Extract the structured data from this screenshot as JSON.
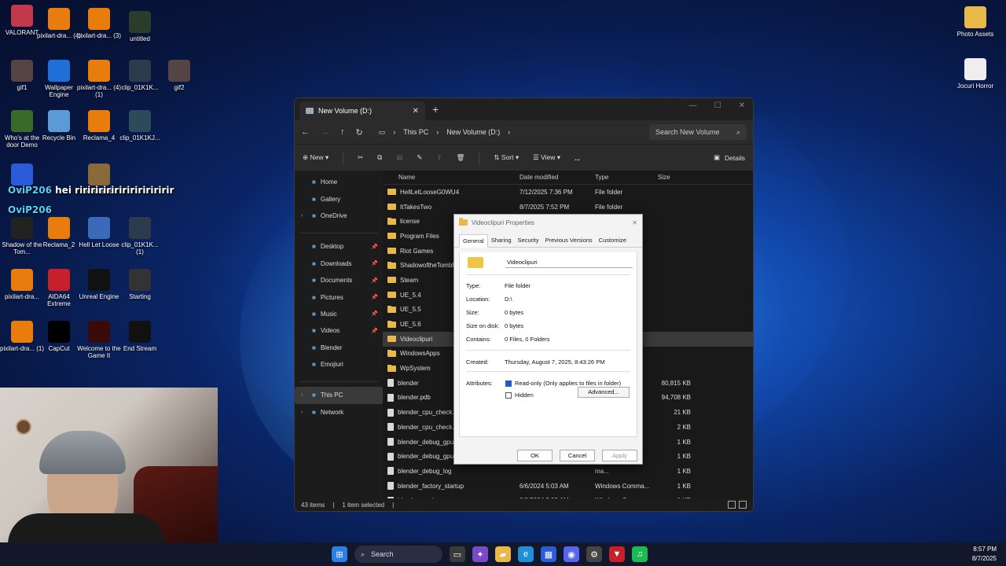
{
  "desktop": {
    "icons": [
      {
        "label": "VALORANT",
        "icon": "valorant-icon",
        "color": "#c23a4a"
      },
      {
        "label": "pixilart-dra... (4)",
        "icon": "blender-icon",
        "color": "#e87d0d"
      },
      {
        "label": "pixilart-dra... (3)",
        "icon": "blender-icon",
        "color": "#e87d0d"
      },
      {
        "label": "untitled",
        "icon": "image-icon",
        "color": "#2c3c2c"
      },
      {
        "label": "gif1",
        "icon": "image-icon",
        "color": "#554444"
      },
      {
        "label": "Wallpaper Engine",
        "icon": "wallpaper-engine-icon",
        "color": "#1f6fd8"
      },
      {
        "label": "pixilart-dra... (4) (1)",
        "icon": "blender-icon",
        "color": "#e87d0d"
      },
      {
        "label": "clip_01K1K...",
        "icon": "video-icon",
        "color": "#2b3b4b"
      },
      {
        "label": "gif2",
        "icon": "image-icon",
        "color": "#554444"
      },
      {
        "label": "Who's at the door Demo",
        "icon": "game-icon",
        "color": "#3a6a2a"
      },
      {
        "label": "Recycle Bin",
        "icon": "recycle-bin-icon",
        "color": "#5b9bd5"
      },
      {
        "label": "Reclama_4",
        "icon": "blender-icon",
        "color": "#e87d0d"
      },
      {
        "label": "clip_01K1KJ...",
        "icon": "video-icon",
        "color": "#2b4b5b"
      },
      {
        "label": "Ro",
        "icon": "roblox-icon",
        "color": "#2a5bd8"
      },
      {
        "label": "Mechanic",
        "icon": "game-icon",
        "color": "#8a6a3a"
      },
      {
        "label": "Shadow of the Tom...",
        "icon": "game-icon",
        "color": "#222222"
      },
      {
        "label": "Reclama_2",
        "icon": "blender-icon",
        "color": "#e87d0d"
      },
      {
        "label": "Hell Let Loose",
        "icon": "game-icon",
        "color": "#3a6ab8"
      },
      {
        "label": "clip_01K1K... (1)",
        "icon": "video-icon",
        "color": "#2b3b4b"
      },
      {
        "label": "pixilart-dra...",
        "icon": "blender-icon",
        "color": "#e87d0d"
      },
      {
        "label": "AIDA64 Extreme",
        "icon": "aida64-icon",
        "color": "#c8202a"
      },
      {
        "label": "Unreal Engine",
        "icon": "unreal-icon",
        "color": "#111111"
      },
      {
        "label": "Starting",
        "icon": "image-icon",
        "color": "#333333"
      },
      {
        "label": "pixilart-dra... (1)",
        "icon": "blender-icon",
        "color": "#e87d0d"
      },
      {
        "label": "CapCut",
        "icon": "capcut-icon",
        "color": "#000000"
      },
      {
        "label": "Welcome to the Game II",
        "icon": "game-icon",
        "color": "#3a0a0a"
      },
      {
        "label": "End Stream",
        "icon": "image-icon",
        "color": "#111111"
      },
      {
        "label": "Photo Assets",
        "icon": "folder-icon",
        "color": "#e8b84a"
      },
      {
        "label": "Jocuri Horror",
        "icon": "file-icon",
        "color": "#eeeeee"
      }
    ]
  },
  "chat": [
    {
      "user": "OviP206",
      "message": "hei ririririririririririririr"
    },
    {
      "user": "OviP206",
      "message": ""
    }
  ],
  "explorer": {
    "tab_title": "New Volume (D:)",
    "breadcrumb": [
      "This PC",
      "New Volume (D:)"
    ],
    "search_placeholder": "Search New Volume",
    "toolbar": {
      "new": "New",
      "sort": "Sort",
      "view": "View",
      "more": "...",
      "details": "Details"
    },
    "nav": {
      "top": [
        {
          "label": "Home",
          "icon": "home-icon",
          "pinned": false
        },
        {
          "label": "Gallery",
          "icon": "gallery-icon",
          "pinned": false
        },
        {
          "label": "OneDrive",
          "icon": "onedrive-icon",
          "pinned": false
        }
      ],
      "quick": [
        {
          "label": "Desktop",
          "icon": "desktop-icon"
        },
        {
          "label": "Downloads",
          "icon": "download-icon"
        },
        {
          "label": "Documents",
          "icon": "documents-icon"
        },
        {
          "label": "Pictures",
          "icon": "pictures-icon"
        },
        {
          "label": "Music",
          "icon": "music-icon"
        },
        {
          "label": "Videos",
          "icon": "videos-icon"
        },
        {
          "label": "Blender",
          "icon": "folder-icon"
        },
        {
          "label": "Emojiuri",
          "icon": "folder-icon"
        }
      ],
      "bottom": [
        {
          "label": "This PC",
          "icon": "this-pc-icon",
          "selected": true
        },
        {
          "label": "Network",
          "icon": "network-icon",
          "selected": false
        }
      ]
    },
    "columns": {
      "name": "Name",
      "date": "Date modified",
      "type": "Type",
      "size": "Size"
    },
    "rows": [
      {
        "name": "HellLetLooseG0WU4",
        "date": "7/12/2025 7:36 PM",
        "type": "File folder",
        "size": "",
        "kind": "folder"
      },
      {
        "name": "ItTakesTwo",
        "date": "8/7/2025 7:52 PM",
        "type": "File folder",
        "size": "",
        "kind": "folder"
      },
      {
        "name": "license",
        "date": "",
        "type": "",
        "size": "",
        "kind": "folder"
      },
      {
        "name": "Program Files",
        "date": "",
        "type": "",
        "size": "",
        "kind": "folder"
      },
      {
        "name": "Riot Games",
        "date": "",
        "type": "",
        "size": "",
        "kind": "folder"
      },
      {
        "name": "ShadowoftheTombR",
        "date": "",
        "type": "",
        "size": "",
        "kind": "folder"
      },
      {
        "name": "Steam",
        "date": "",
        "type": "",
        "size": "",
        "kind": "folder"
      },
      {
        "name": "UE_5.4",
        "date": "",
        "type": "",
        "size": "",
        "kind": "folder"
      },
      {
        "name": "UE_5.5",
        "date": "",
        "type": "",
        "size": "",
        "kind": "folder"
      },
      {
        "name": "UE_5.6",
        "date": "",
        "type": "",
        "size": "",
        "kind": "folder"
      },
      {
        "name": "Videoclipuri",
        "date": "",
        "type": "",
        "size": "",
        "kind": "folder",
        "selected": true
      },
      {
        "name": "WindowsApps",
        "date": "",
        "type": "",
        "size": "",
        "kind": "folder"
      },
      {
        "name": "WpSystem",
        "date": "",
        "type": "",
        "size": "",
        "kind": "folder"
      },
      {
        "name": "blender",
        "date": "",
        "type": "",
        "size": "80,815 KB",
        "kind": "file"
      },
      {
        "name": "blender.pdb",
        "date": "",
        "type": "D...",
        "size": "94,708 KB",
        "kind": "file"
      },
      {
        "name": "blender_cpu_check.",
        "date": "",
        "type": "ns",
        "size": "21 KB",
        "kind": "file"
      },
      {
        "name": "blender_cpu_check.l",
        "date": "",
        "type": "ry",
        "size": "2 KB",
        "kind": "file"
      },
      {
        "name": "blender_debug_gpu",
        "date": "",
        "type": "ma...",
        "size": "1 KB",
        "kind": "file"
      },
      {
        "name": "blender_debug_gpu_",
        "date": "",
        "type": "ma...",
        "size": "1 KB",
        "kind": "file"
      },
      {
        "name": "blender_debug_log",
        "date": "",
        "type": "ma...",
        "size": "1 KB",
        "kind": "file"
      },
      {
        "name": "blender_factory_startup",
        "date": "6/6/2024 5:03 AM",
        "type": "Windows Comma...",
        "size": "1 KB",
        "kind": "file"
      },
      {
        "name": "blender_oculus",
        "date": "6/6/2024 5:03 AM",
        "type": "Windows Comma...",
        "size": "1 KB",
        "kind": "file"
      }
    ],
    "status": {
      "count": "43 items",
      "selected": "1 item selected"
    }
  },
  "dialog": {
    "title": "Videoclipuri Properties",
    "tabs": [
      "General",
      "Sharing",
      "Security",
      "Previous Versions",
      "Customize"
    ],
    "folder_name": "Videoclipuri",
    "props": [
      {
        "k": "Type:",
        "v": "File folder"
      },
      {
        "k": "Location:",
        "v": "D:\\"
      },
      {
        "k": "Size:",
        "v": "0 bytes"
      },
      {
        "k": "Size on disk:",
        "v": "0 bytes"
      },
      {
        "k": "Contains:",
        "v": "0 Files, 0 Folders"
      }
    ],
    "created_label": "Created:",
    "created_value": "Thursday, August 7, 2025, 8:43:26 PM",
    "attributes_label": "Attributes:",
    "readonly_label": "Read-only (Only applies to files in folder)",
    "hidden_label": "Hidden",
    "advanced_label": "Advanced...",
    "ok": "OK",
    "cancel": "Cancel",
    "apply": "Apply"
  },
  "taskbar": {
    "search": "Search",
    "time": "8:57 PM",
    "date": "8/7/2025"
  }
}
